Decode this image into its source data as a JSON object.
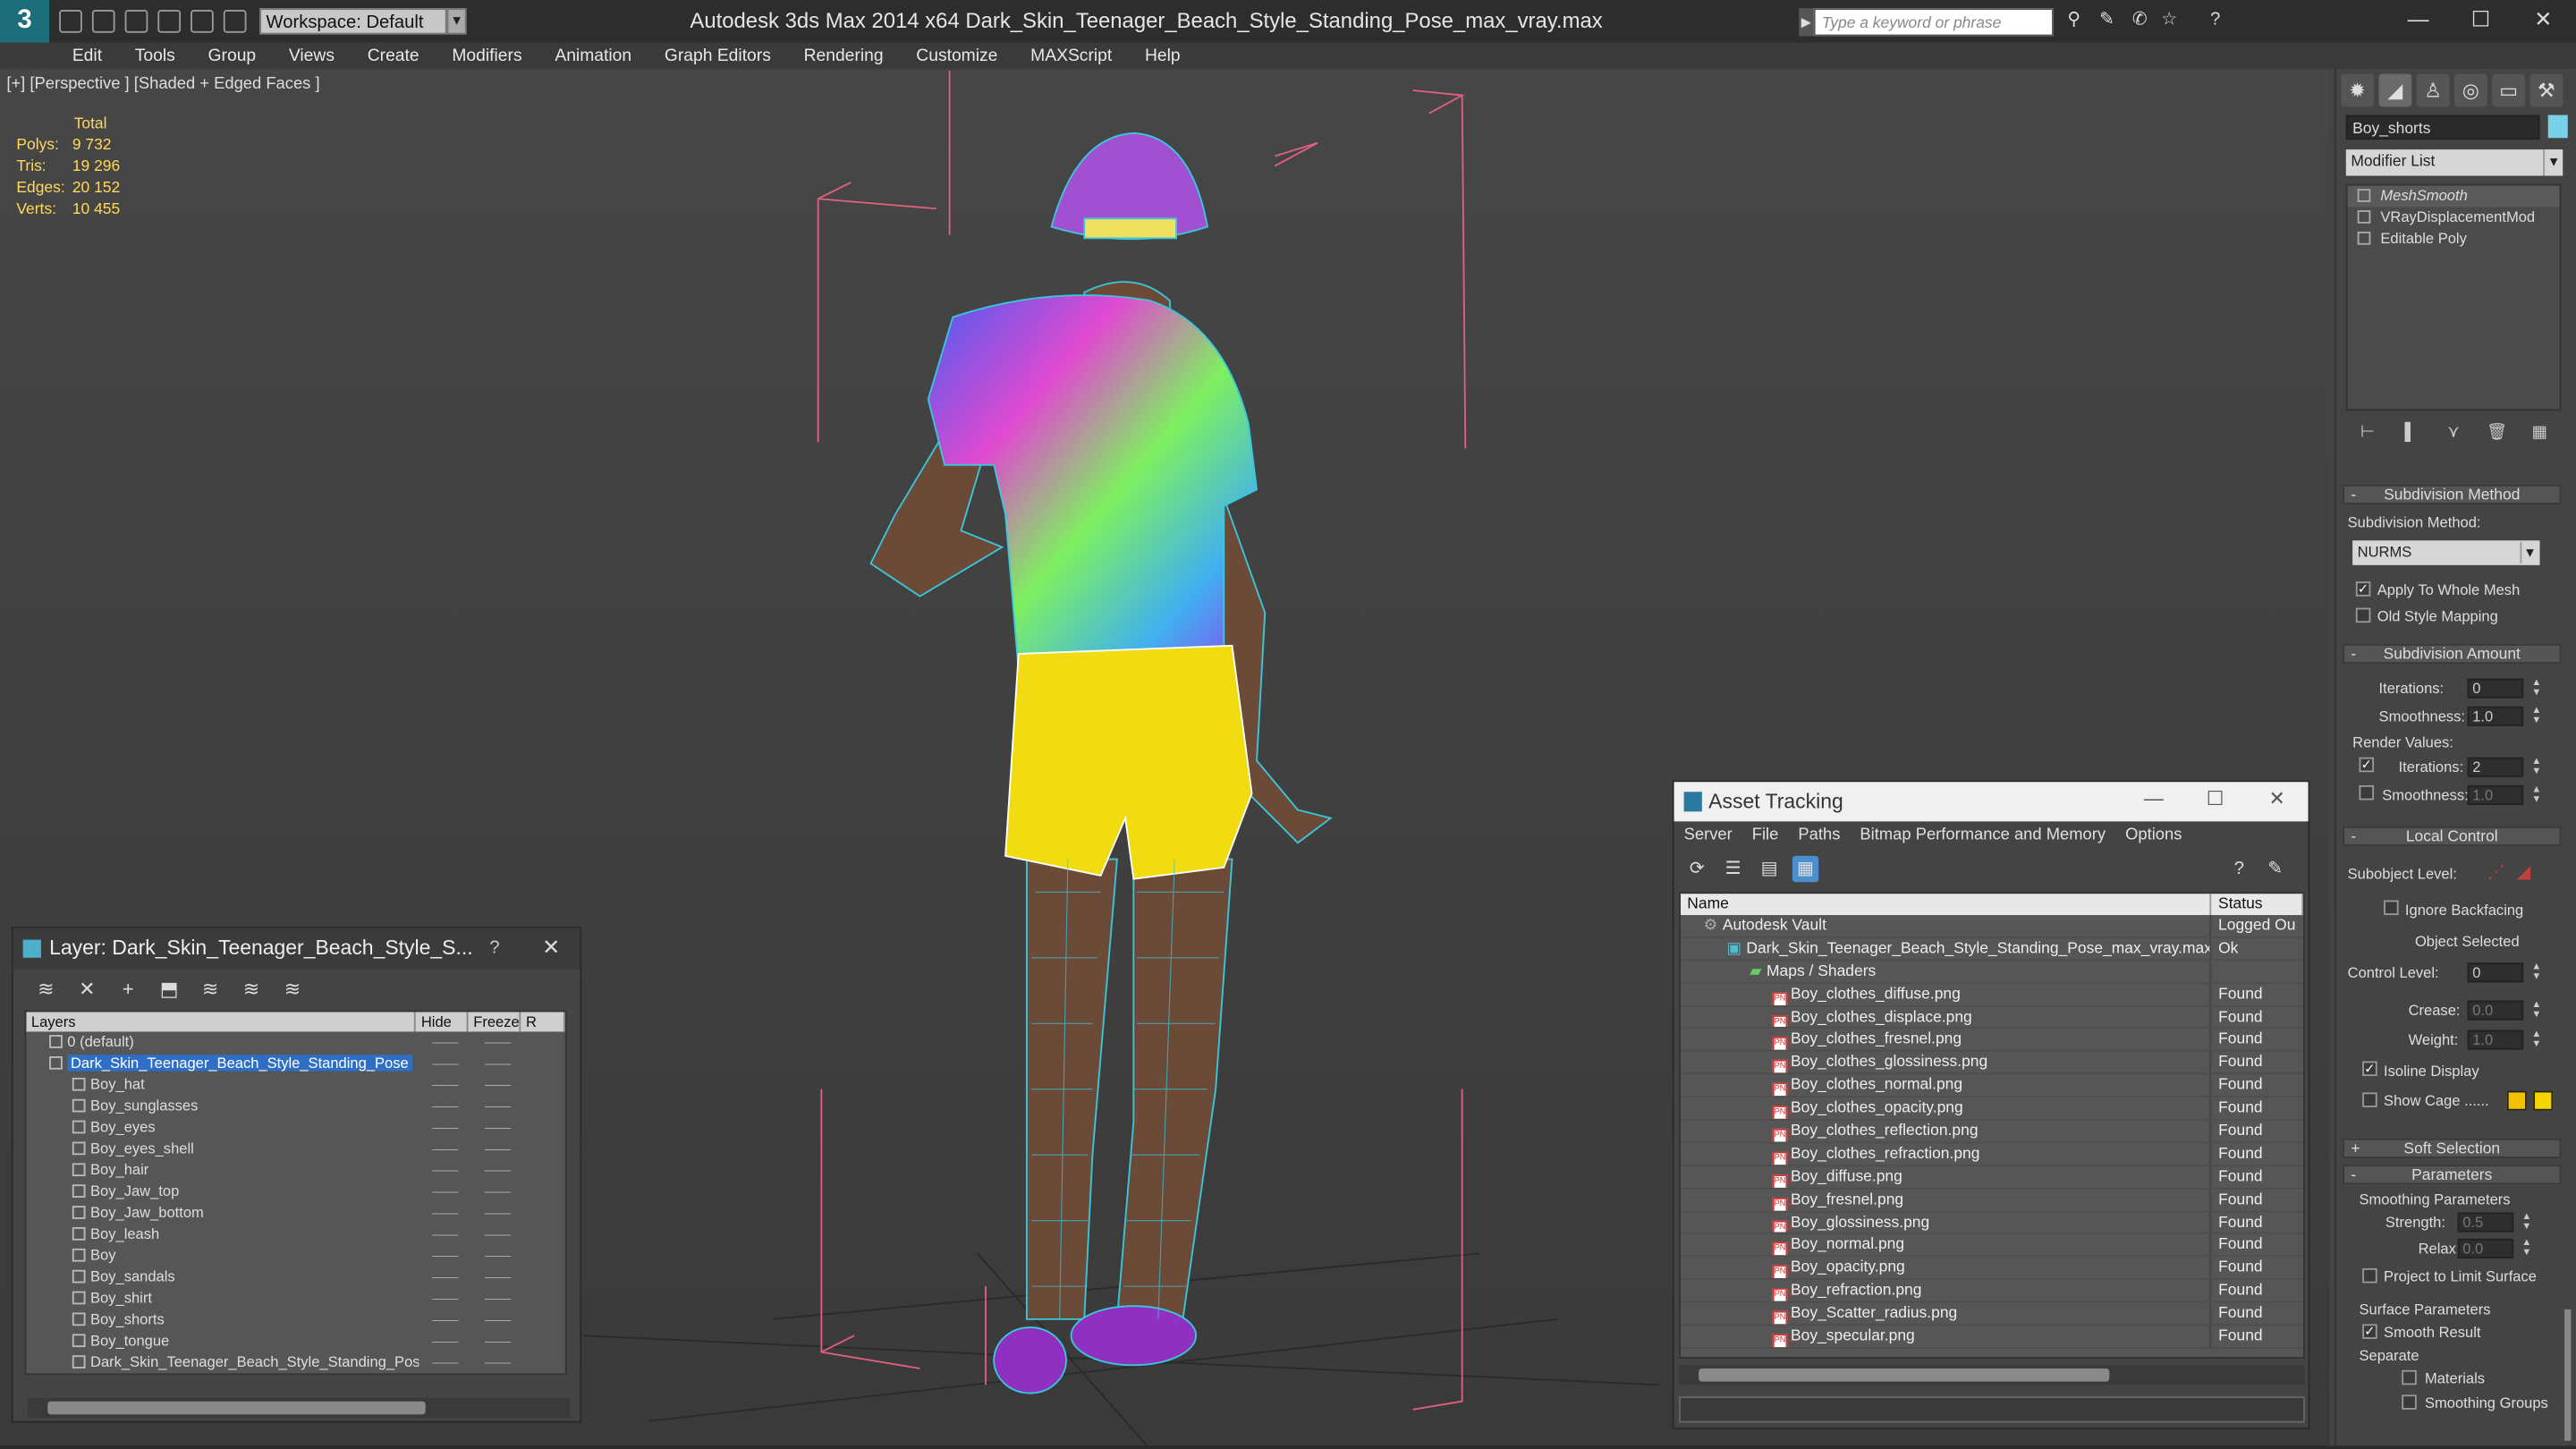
{
  "titlebar": {
    "app_title": "Autodesk 3ds Max  2014 x64       Dark_Skin_Teenager_Beach_Style_Standing_Pose_max_vray.max",
    "workspace": "Workspace: Default",
    "search_placeholder": "Type a keyword or phrase",
    "logo": "3",
    "minimize": "—",
    "maximize": "☐",
    "close": "✕"
  },
  "menubar": {
    "items": [
      "Edit",
      "Tools",
      "Group",
      "Views",
      "Create",
      "Modifiers",
      "Animation",
      "Graph Editors",
      "Rendering",
      "Customize",
      "MAXScript",
      "Help"
    ]
  },
  "viewport": {
    "label": "[+] [Perspective ] [Shaded + Edged Faces ]",
    "stats": {
      "header": "Total",
      "rows": [
        {
          "label": "Polys:",
          "value": "9 732"
        },
        {
          "label": "Tris:",
          "value": "19 296"
        },
        {
          "label": "Edges:",
          "value": "20 152"
        },
        {
          "label": "Verts:",
          "value": "10 455"
        }
      ]
    }
  },
  "command_panel": {
    "object_name": "Boy_shorts",
    "modifier_list": "Modifier List",
    "stack": [
      "MeshSmooth",
      "VRayDisplacementMod",
      "Editable Poly"
    ],
    "subdivision_method": {
      "title": "Subdivision Method",
      "label": "Subdivision Method:",
      "value": "NURMS",
      "apply_whole_mesh": "Apply To Whole Mesh",
      "old_style_mapping": "Old Style Mapping"
    },
    "subdivision_amount": {
      "title": "Subdivision Amount",
      "iterations_label": "Iterations:",
      "iterations": "0",
      "smoothness_label": "Smoothness:",
      "smoothness": "1.0",
      "render_values": "Render Values:",
      "render_iterations": "2",
      "render_smoothness": "1.0"
    },
    "local_control": {
      "title": "Local Control",
      "subobject_level": "Subobject Level:",
      "ignore_backfacing": "Ignore Backfacing",
      "object_selected": "Object Selected",
      "control_level_label": "Control Level:",
      "control_level": "0",
      "crease_label": "Crease:",
      "crease": "0.0",
      "weight_label": "Weight:",
      "weight": "1.0",
      "isoline_display": "Isoline Display",
      "show_cage": "Show Cage ......"
    },
    "soft_selection": "Soft Selection",
    "parameters": {
      "title": "Parameters",
      "smoothing_parameters": "Smoothing Parameters",
      "strength_label": "Strength:",
      "strength": "0.5",
      "relax_label": "Relax:",
      "relax": "0.0",
      "project_limit": "Project to Limit Surface",
      "surface_parameters": "Surface Parameters",
      "smooth_result": "Smooth Result",
      "separate": "Separate",
      "materials": "Materials",
      "smoothing_groups": "Smoothing Groups"
    },
    "colors": {
      "object_color": "#7ad0e8",
      "cage_color_1": "#f2c200",
      "cage_color_2": "#f5d400"
    }
  },
  "layer_dialog": {
    "title": "Layer: Dark_Skin_Teenager_Beach_Style_S...",
    "help": "?",
    "close": "✕",
    "columns": [
      "Layers",
      "Hide",
      "Freeze",
      "R"
    ],
    "rows": [
      {
        "name": "0 (default)",
        "indent": 1,
        "selected": false,
        "mark": "☐"
      },
      {
        "name": "Dark_Skin_Teenager_Beach_Style_Standing_Pose",
        "indent": 1,
        "selected": true,
        "mark": "✓"
      },
      {
        "name": "Boy_hat",
        "indent": 2
      },
      {
        "name": "Boy_sunglasses",
        "indent": 2
      },
      {
        "name": "Boy_eyes",
        "indent": 2
      },
      {
        "name": "Boy_eyes_shell",
        "indent": 2
      },
      {
        "name": "Boy_hair",
        "indent": 2
      },
      {
        "name": "Boy_Jaw_top",
        "indent": 2
      },
      {
        "name": "Boy_Jaw_bottom",
        "indent": 2
      },
      {
        "name": "Boy_leash",
        "indent": 2
      },
      {
        "name": "Boy",
        "indent": 2
      },
      {
        "name": "Boy_sandals",
        "indent": 2
      },
      {
        "name": "Boy_shirt",
        "indent": 2
      },
      {
        "name": "Boy_shorts",
        "indent": 2
      },
      {
        "name": "Boy_tongue",
        "indent": 2
      },
      {
        "name": "Dark_Skin_Teenager_Beach_Style_Standing_Pose",
        "indent": 2
      }
    ]
  },
  "asset_dialog": {
    "title": "Asset Tracking",
    "menu": [
      "Server",
      "File",
      "Paths",
      "Bitmap Performance and Memory",
      "Options"
    ],
    "columns": [
      "Name",
      "Status"
    ],
    "rows": [
      {
        "name": "Autodesk Vault",
        "status": "Logged Ou",
        "level": 0,
        "type": "vault"
      },
      {
        "name": "Dark_Skin_Teenager_Beach_Style_Standing_Pose_max_vray.max",
        "status": "Ok",
        "level": 1,
        "type": "max"
      },
      {
        "name": "Maps / Shaders",
        "status": "",
        "level": 2,
        "type": "folder"
      },
      {
        "name": "Boy_clothes_diffuse.png",
        "status": "Found",
        "level": 3,
        "type": "png"
      },
      {
        "name": "Boy_clothes_displace.png",
        "status": "Found",
        "level": 3,
        "type": "png"
      },
      {
        "name": "Boy_clothes_fresnel.png",
        "status": "Found",
        "level": 3,
        "type": "png"
      },
      {
        "name": "Boy_clothes_glossiness.png",
        "status": "Found",
        "level": 3,
        "type": "png"
      },
      {
        "name": "Boy_clothes_normal.png",
        "status": "Found",
        "level": 3,
        "type": "png"
      },
      {
        "name": "Boy_clothes_opacity.png",
        "status": "Found",
        "level": 3,
        "type": "png"
      },
      {
        "name": "Boy_clothes_reflection.png",
        "status": "Found",
        "level": 3,
        "type": "png"
      },
      {
        "name": "Boy_clothes_refraction.png",
        "status": "Found",
        "level": 3,
        "type": "png"
      },
      {
        "name": "Boy_diffuse.png",
        "status": "Found",
        "level": 3,
        "type": "png"
      },
      {
        "name": "Boy_fresnel.png",
        "status": "Found",
        "level": 3,
        "type": "png"
      },
      {
        "name": "Boy_glossiness.png",
        "status": "Found",
        "level": 3,
        "type": "png"
      },
      {
        "name": "Boy_normal.png",
        "status": "Found",
        "level": 3,
        "type": "png"
      },
      {
        "name": "Boy_opacity.png",
        "status": "Found",
        "level": 3,
        "type": "png"
      },
      {
        "name": "Boy_refraction.png",
        "status": "Found",
        "level": 3,
        "type": "png"
      },
      {
        "name": "Boy_Scatter_radius.png",
        "status": "Found",
        "level": 3,
        "type": "png"
      },
      {
        "name": "Boy_specular.png",
        "status": "Found",
        "level": 3,
        "type": "png"
      }
    ]
  }
}
